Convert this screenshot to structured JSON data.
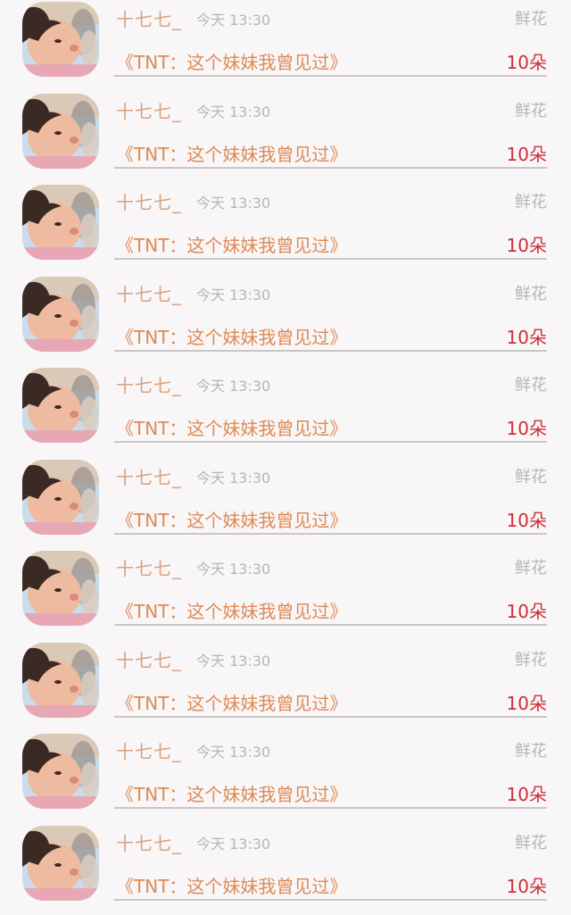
{
  "gift_records": [
    {
      "user": "十七七_",
      "time": "今天 13:30",
      "gift": "鲜花",
      "book": "《TNT：这个妹妹我曾见过》",
      "count": "10朵"
    },
    {
      "user": "十七七_",
      "time": "今天 13:30",
      "gift": "鲜花",
      "book": "《TNT：这个妹妹我曾见过》",
      "count": "10朵"
    },
    {
      "user": "十七七_",
      "time": "今天 13:30",
      "gift": "鲜花",
      "book": "《TNT：这个妹妹我曾见过》",
      "count": "10朵"
    },
    {
      "user": "十七七_",
      "time": "今天 13:30",
      "gift": "鲜花",
      "book": "《TNT：这个妹妹我曾见过》",
      "count": "10朵"
    },
    {
      "user": "十七七_",
      "time": "今天 13:30",
      "gift": "鲜花",
      "book": "《TNT：这个妹妹我曾见过》",
      "count": "10朵"
    },
    {
      "user": "十七七_",
      "time": "今天 13:30",
      "gift": "鲜花",
      "book": "《TNT：这个妹妹我曾见过》",
      "count": "10朵"
    },
    {
      "user": "十七七_",
      "time": "今天 13:30",
      "gift": "鲜花",
      "book": "《TNT：这个妹妹我曾见过》",
      "count": "10朵"
    },
    {
      "user": "十七七_",
      "time": "今天 13:30",
      "gift": "鲜花",
      "book": "《TNT：这个妹妹我曾见过》",
      "count": "10朵"
    },
    {
      "user": "十七七_",
      "time": "今天 13:30",
      "gift": "鲜花",
      "book": "《TNT：这个妹妹我曾见过》",
      "count": "10朵"
    },
    {
      "user": "十七七_",
      "time": "今天 13:30",
      "gift": "鲜花",
      "book": "《TNT：这个妹妹我曾见过》",
      "count": "10朵"
    }
  ],
  "colors": {
    "background": "#f8f6f6",
    "username": "#d9a27e",
    "book_title": "#dd8a56",
    "count": "#cc2f3a",
    "muted": "#b6b6b6",
    "divider": "#c9c6c6"
  }
}
